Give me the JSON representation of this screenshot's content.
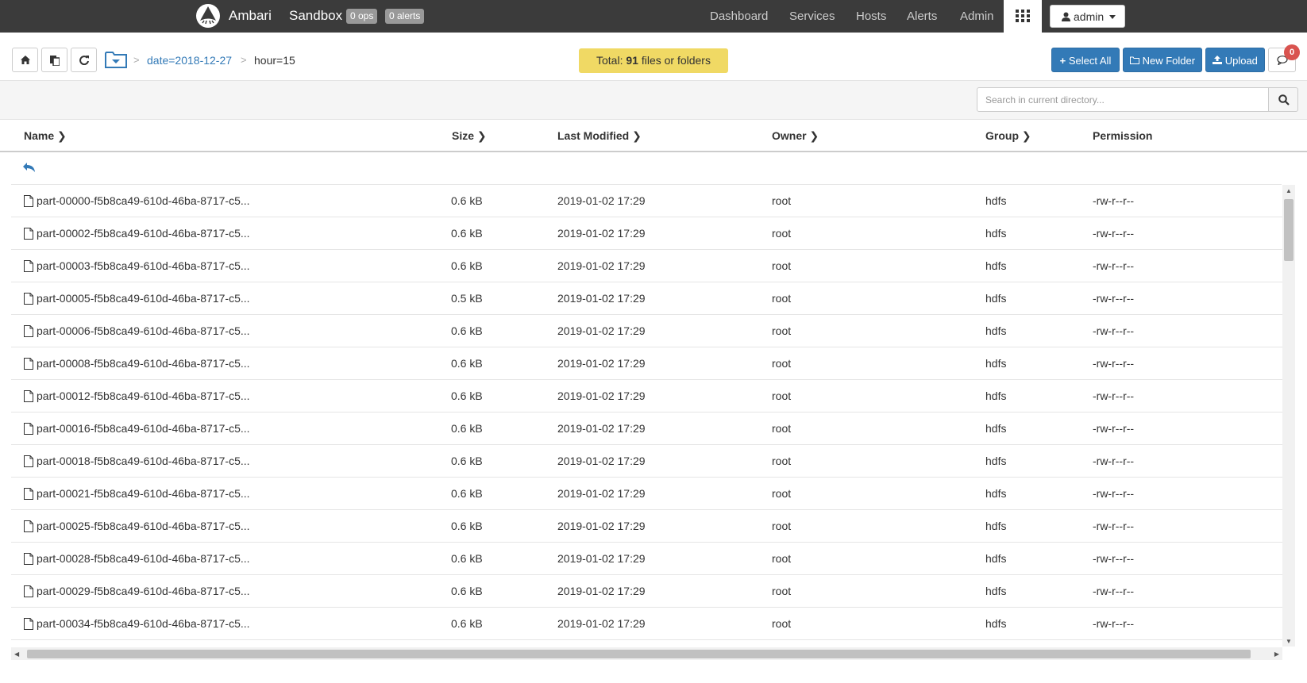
{
  "topbar": {
    "brand": "Ambari",
    "cluster": "Sandbox",
    "ops_badge": "0 ops",
    "alerts_badge": "0 alerts",
    "nav": [
      "Dashboard",
      "Services",
      "Hosts",
      "Alerts",
      "Admin"
    ],
    "user": "admin"
  },
  "toolbar": {
    "breadcrumbs": [
      "date=2018-12-27",
      "hour=15"
    ],
    "total_prefix": "Total:",
    "total_count": "91",
    "total_suffix": "files or folders",
    "select_all": "Select All",
    "new_folder": "New Folder",
    "upload": "Upload",
    "messages_count": "0"
  },
  "search": {
    "placeholder": "Search in current directory..."
  },
  "table": {
    "columns": [
      "Name",
      "Size",
      "Last Modified",
      "Owner",
      "Group",
      "Permission"
    ],
    "rows": [
      {
        "name": "part-00000-f5b8ca49-610d-46ba-8717-c5...",
        "size": "0.6 kB",
        "modified": "2019-01-02 17:29",
        "owner": "root",
        "group": "hdfs",
        "permission": "-rw-r--r--"
      },
      {
        "name": "part-00002-f5b8ca49-610d-46ba-8717-c5...",
        "size": "0.6 kB",
        "modified": "2019-01-02 17:29",
        "owner": "root",
        "group": "hdfs",
        "permission": "-rw-r--r--"
      },
      {
        "name": "part-00003-f5b8ca49-610d-46ba-8717-c5...",
        "size": "0.6 kB",
        "modified": "2019-01-02 17:29",
        "owner": "root",
        "group": "hdfs",
        "permission": "-rw-r--r--"
      },
      {
        "name": "part-00005-f5b8ca49-610d-46ba-8717-c5...",
        "size": "0.5 kB",
        "modified": "2019-01-02 17:29",
        "owner": "root",
        "group": "hdfs",
        "permission": "-rw-r--r--"
      },
      {
        "name": "part-00006-f5b8ca49-610d-46ba-8717-c5...",
        "size": "0.6 kB",
        "modified": "2019-01-02 17:29",
        "owner": "root",
        "group": "hdfs",
        "permission": "-rw-r--r--"
      },
      {
        "name": "part-00008-f5b8ca49-610d-46ba-8717-c5...",
        "size": "0.6 kB",
        "modified": "2019-01-02 17:29",
        "owner": "root",
        "group": "hdfs",
        "permission": "-rw-r--r--"
      },
      {
        "name": "part-00012-f5b8ca49-610d-46ba-8717-c5...",
        "size": "0.6 kB",
        "modified": "2019-01-02 17:29",
        "owner": "root",
        "group": "hdfs",
        "permission": "-rw-r--r--"
      },
      {
        "name": "part-00016-f5b8ca49-610d-46ba-8717-c5...",
        "size": "0.6 kB",
        "modified": "2019-01-02 17:29",
        "owner": "root",
        "group": "hdfs",
        "permission": "-rw-r--r--"
      },
      {
        "name": "part-00018-f5b8ca49-610d-46ba-8717-c5...",
        "size": "0.6 kB",
        "modified": "2019-01-02 17:29",
        "owner": "root",
        "group": "hdfs",
        "permission": "-rw-r--r--"
      },
      {
        "name": "part-00021-f5b8ca49-610d-46ba-8717-c5...",
        "size": "0.6 kB",
        "modified": "2019-01-02 17:29",
        "owner": "root",
        "group": "hdfs",
        "permission": "-rw-r--r--"
      },
      {
        "name": "part-00025-f5b8ca49-610d-46ba-8717-c5...",
        "size": "0.6 kB",
        "modified": "2019-01-02 17:29",
        "owner": "root",
        "group": "hdfs",
        "permission": "-rw-r--r--"
      },
      {
        "name": "part-00028-f5b8ca49-610d-46ba-8717-c5...",
        "size": "0.6 kB",
        "modified": "2019-01-02 17:29",
        "owner": "root",
        "group": "hdfs",
        "permission": "-rw-r--r--"
      },
      {
        "name": "part-00029-f5b8ca49-610d-46ba-8717-c5...",
        "size": "0.6 kB",
        "modified": "2019-01-02 17:29",
        "owner": "root",
        "group": "hdfs",
        "permission": "-rw-r--r--"
      },
      {
        "name": "part-00034-f5b8ca49-610d-46ba-8717-c5...",
        "size": "0.6 kB",
        "modified": "2019-01-02 17:29",
        "owner": "root",
        "group": "hdfs",
        "permission": "-rw-r--r--"
      }
    ]
  },
  "colors": {
    "topbar": "#3b3b3b",
    "primary": "#337ab7",
    "total_bg": "#f0d964",
    "badge_red": "#d9534f"
  }
}
